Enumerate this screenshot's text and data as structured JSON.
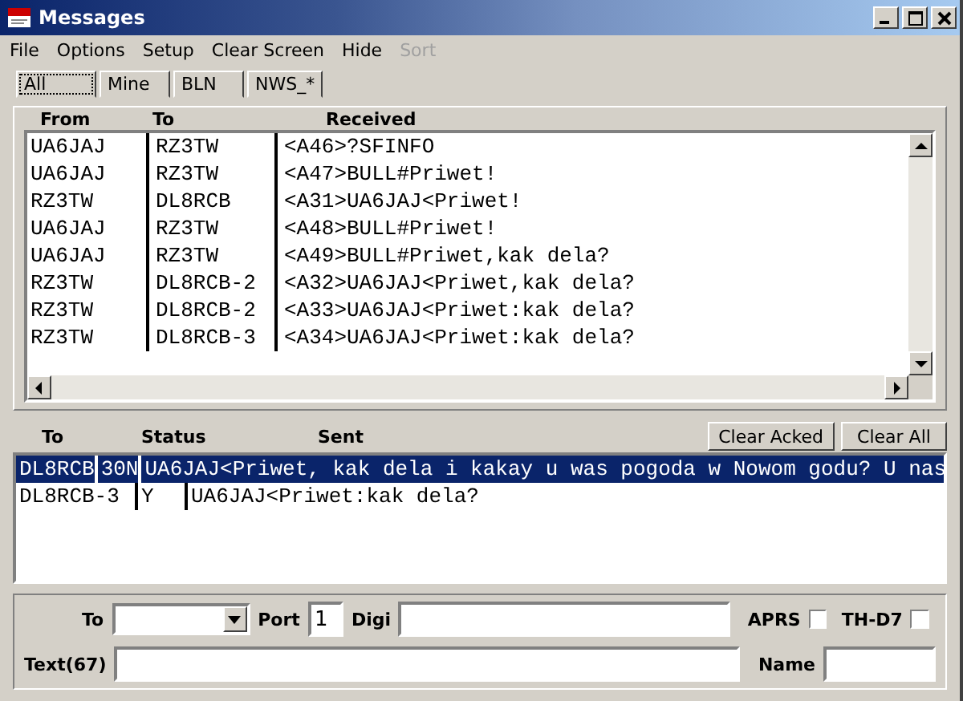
{
  "window": {
    "title": "Messages"
  },
  "menu": [
    {
      "label": "File",
      "disabled": false
    },
    {
      "label": "Options",
      "disabled": false
    },
    {
      "label": "Setup",
      "disabled": false
    },
    {
      "label": "Clear Screen",
      "disabled": false
    },
    {
      "label": "Hide",
      "disabled": false
    },
    {
      "label": "Sort",
      "disabled": true
    }
  ],
  "tabs": [
    {
      "label": "All",
      "selected": true
    },
    {
      "label": "Mine",
      "selected": false
    },
    {
      "label": "BLN",
      "selected": false
    },
    {
      "label": "NWS_*",
      "selected": false
    }
  ],
  "received": {
    "columns": [
      "From",
      "To",
      "Received"
    ],
    "rows": [
      {
        "from": "UA6JAJ",
        "to": "RZ3TW",
        "text": "<A46>?SFINFO"
      },
      {
        "from": "UA6JAJ",
        "to": "RZ3TW",
        "text": "<A47>BULL#Priwet!"
      },
      {
        "from": "RZ3TW",
        "to": "DL8RCB",
        "text": "<A31>UA6JAJ<Priwet!"
      },
      {
        "from": "UA6JAJ",
        "to": "RZ3TW",
        "text": "<A48>BULL#Priwet!"
      },
      {
        "from": "UA6JAJ",
        "to": "RZ3TW",
        "text": "<A49>BULL#Priwet,kak dela?"
      },
      {
        "from": "RZ3TW",
        "to": "DL8RCB-2",
        "text": "<A32>UA6JAJ<Priwet,kak dela?"
      },
      {
        "from": "RZ3TW",
        "to": "DL8RCB-2",
        "text": "<A33>UA6JAJ<Priwet:kak dela?"
      },
      {
        "from": "RZ3TW",
        "to": "DL8RCB-3",
        "text": "<A34>UA6JAJ<Priwet:kak dela?"
      }
    ]
  },
  "sent": {
    "columns": [
      "To",
      "Status",
      "Sent"
    ],
    "buttons": [
      "Clear Acked",
      "Clear All"
    ],
    "rows": [
      {
        "to": "DL8RCB",
        "status": "30N",
        "text": "UA6JAJ<Priwet, kak dela i kakay u was pogoda w Nowom godu? U nas",
        "selected": true
      },
      {
        "to": "DL8RCB-3",
        "status": "Y",
        "text": "UA6JAJ<Priwet:kak dela?",
        "selected": false
      }
    ]
  },
  "compose": {
    "to_label": "To",
    "port_label": "Port",
    "port_value": "1",
    "digi_label": "Digi",
    "aprs": {
      "label": "APRS",
      "checked": false
    },
    "thd7": {
      "label": "TH-D7",
      "checked": false
    },
    "text_label": "Text(67)",
    "name_label": "Name"
  }
}
